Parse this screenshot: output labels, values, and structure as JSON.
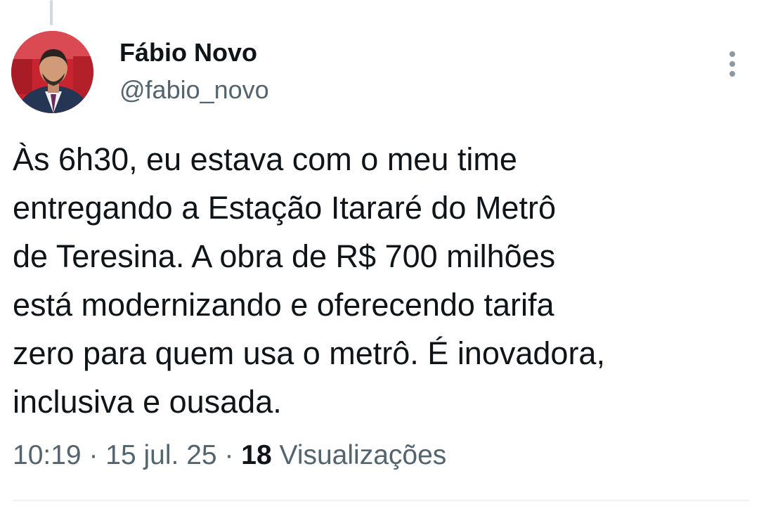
{
  "thread": {
    "connector": "thread-connector"
  },
  "author": {
    "display_name": "Fábio Novo",
    "handle": "@fabio_novo",
    "avatar_icon": "profile-photo"
  },
  "actions": {
    "more_icon": "more-vertical-icon"
  },
  "tweet": {
    "lines": [
      "Às 6h30, eu estava com o meu time",
      "entregando a Estação Itararé do Metrô",
      "de Teresina. A obra de R$ 700 milhões",
      "está modernizando e oferecendo tarifa",
      "zero para quem usa o metrô. É inovadora,",
      "inclusiva e ousada."
    ]
  },
  "meta": {
    "time": "10:19",
    "separator": "·",
    "date": "15 jul. 25",
    "views_count": "18",
    "views_label": "Visualizações"
  },
  "colors": {
    "text_primary": "#0f1419",
    "text_secondary": "#536471",
    "divider": "#eff3f4",
    "thread_line": "#cfd9de"
  }
}
